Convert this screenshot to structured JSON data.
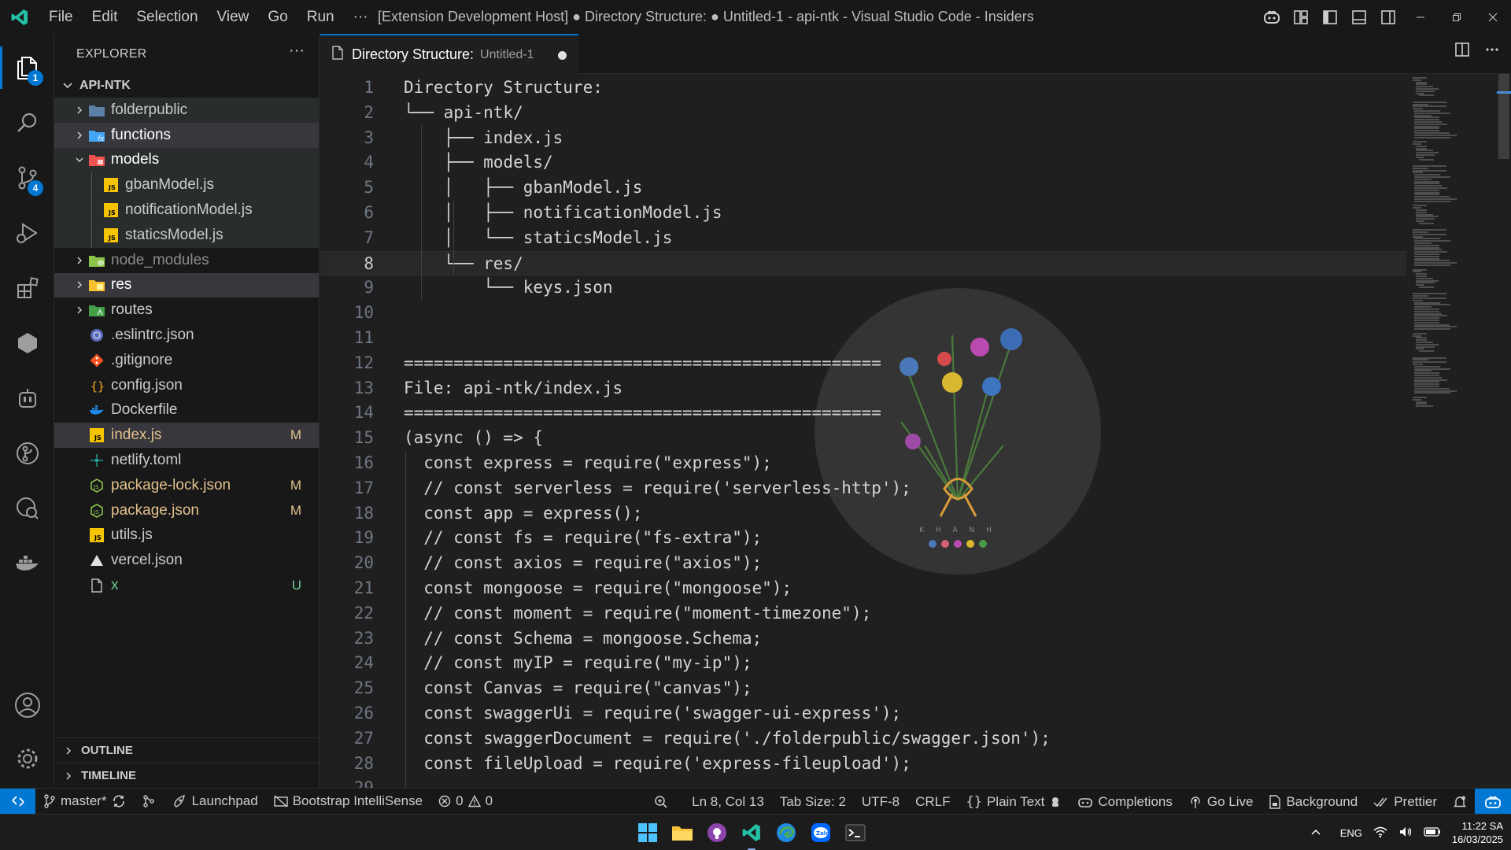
{
  "window": {
    "title": "[Extension Development Host] ● Directory Structure: ● Untitled-1 - api-ntk - Visual Studio Code - Insiders",
    "menu": [
      "File",
      "Edit",
      "Selection",
      "View",
      "Go",
      "Run",
      "···"
    ]
  },
  "activity_bar": {
    "explorer_badge": "1",
    "scm_badge": "4"
  },
  "sidebar": {
    "title": "EXPLORER",
    "more": "···",
    "root": "API-NTK",
    "items": [
      {
        "label": "folderpublic",
        "icon": "folder-public-icon",
        "git": ""
      },
      {
        "label": "functions",
        "icon": "folder-functions-icon",
        "git": ""
      },
      {
        "label": "models",
        "icon": "folder-models-icon",
        "git": ""
      },
      {
        "label": "gbanModel.js",
        "icon": "javascript-icon",
        "git": ""
      },
      {
        "label": "notificationModel.js",
        "icon": "javascript-icon",
        "git": ""
      },
      {
        "label": "staticsModel.js",
        "icon": "javascript-icon",
        "git": ""
      },
      {
        "label": "node_modules",
        "icon": "folder-node-icon",
        "git": ""
      },
      {
        "label": "res",
        "icon": "folder-res-icon",
        "git": ""
      },
      {
        "label": "routes",
        "icon": "folder-routes-icon",
        "git": ""
      },
      {
        "label": ".eslintrc.json",
        "icon": "eslint-icon",
        "git": ""
      },
      {
        "label": ".gitignore",
        "icon": "git-icon",
        "git": ""
      },
      {
        "label": "config.json",
        "icon": "json-icon",
        "git": ""
      },
      {
        "label": "Dockerfile",
        "icon": "docker-icon",
        "git": ""
      },
      {
        "label": "index.js",
        "icon": "javascript-icon",
        "git": "M"
      },
      {
        "label": "netlify.toml",
        "icon": "netlify-icon",
        "git": ""
      },
      {
        "label": "package-lock.json",
        "icon": "nodejs-icon",
        "git": "M"
      },
      {
        "label": "package.json",
        "icon": "nodejs-icon",
        "git": "M"
      },
      {
        "label": "utils.js",
        "icon": "javascript-icon",
        "git": ""
      },
      {
        "label": "vercel.json",
        "icon": "vercel-icon",
        "git": ""
      },
      {
        "label": "x",
        "icon": "file-icon",
        "git": "U"
      }
    ],
    "outline": "OUTLINE",
    "timeline": "TIMELINE"
  },
  "tab": {
    "title": "Directory Structure:",
    "description": "Untitled-1"
  },
  "editor": {
    "lines": [
      "Directory Structure:",
      "└── api-ntk/",
      "    ├── index.js",
      "    ├── models/",
      "    │   ├── gbanModel.js",
      "    │   ├── notificationModel.js",
      "    │   └── staticsModel.js",
      "    └── res/",
      "        └── keys.json",
      "",
      "",
      "================================================",
      "File: api-ntk/index.js",
      "================================================",
      "(async () => {",
      "  const express = require(\"express\");",
      "  // const serverless = require('serverless-http');",
      "  const app = express();",
      "  // const fs = require(\"fs-extra\");",
      "  // const axios = require(\"axios\");",
      "  const mongoose = require(\"mongoose\");",
      "  // const moment = require(\"moment-timezone\");",
      "  // const Schema = mongoose.Schema;",
      "  // const myIP = require(\"my-ip\");",
      "  const Canvas = require(\"canvas\");",
      "  const swaggerUi = require('swagger-ui-express');",
      "  const swaggerDocument = require('./folderpublic/swagger.json');",
      "  const fileUpload = require('express-fileupload');",
      ""
    ],
    "line_numbers": [
      "1",
      "2",
      "3",
      "4",
      "5",
      "6",
      "7",
      "8",
      "9",
      "10",
      "11",
      "12",
      "13",
      "14",
      "15",
      "16",
      "17",
      "18",
      "19",
      "20",
      "21",
      "22",
      "23",
      "24",
      "25",
      "26",
      "27",
      "28",
      "29"
    ],
    "current_line": 8,
    "background_watermark": "K H Á N H"
  },
  "statusbar": {
    "branch": "master*",
    "launchpad": "Launchpad",
    "bootstrap": "Bootstrap IntelliSense",
    "errors": "0",
    "warnings": "0",
    "position": "Ln 8, Col 13",
    "tab_size": "Tab Size: 2",
    "encoding": "UTF-8",
    "eol": "CRLF",
    "language": "Plain Text",
    "completions": "Completions",
    "go_live": "Go Live",
    "background": "Background",
    "prettier": "Prettier"
  },
  "taskbar": {
    "lang": "ENG",
    "time": "11:22 SA",
    "date": "16/03/2025"
  },
  "colors": {
    "accent": "#0078d4",
    "modified": "#e2c08d",
    "untracked": "#73c991"
  }
}
